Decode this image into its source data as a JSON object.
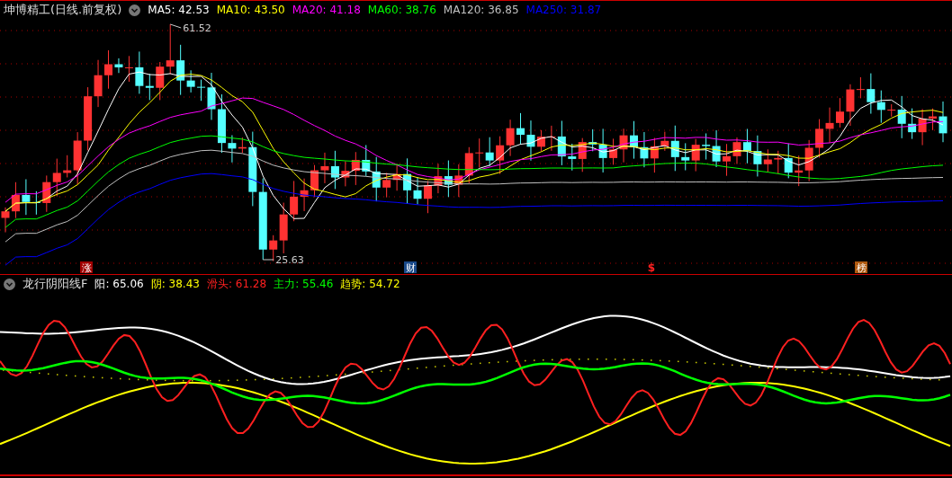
{
  "main_panel": {
    "title": "坤博精工(日线.前复权)",
    "legend": [
      {
        "label": "MA5: 42.53",
        "color": "#ffffff"
      },
      {
        "label": "MA10: 43.50",
        "color": "#ffff00"
      },
      {
        "label": "MA20: 41.18",
        "color": "#ff00ff"
      },
      {
        "label": "MA60: 38.76",
        "color": "#00ff00"
      },
      {
        "label": "MA120: 36.85",
        "color": "#c0c0c0"
      },
      {
        "label": "MA250: 31.87",
        "color": "#0000ff"
      }
    ],
    "high_label": "61.52",
    "low_label": "25.63",
    "markers": [
      {
        "label": "涨",
        "kind": "badge",
        "color": "#a00000"
      },
      {
        "label": "财",
        "kind": "badge",
        "color": "#1a4a8a"
      },
      {
        "label": "$",
        "kind": "text",
        "color": "#ff2020"
      },
      {
        "label": "榜",
        "kind": "badge",
        "color": "#b05a10"
      }
    ]
  },
  "indicator_panel": {
    "title": "龙行阴阳线F",
    "legend": [
      {
        "label": "阳: 65.06",
        "color": "#ffffff"
      },
      {
        "label": "阴: 38.43",
        "color": "#ffff00"
      },
      {
        "label": "滑头: 61.28",
        "color": "#ff2020"
      },
      {
        "label": "主力: 55.46",
        "color": "#00ff00"
      },
      {
        "label": "趋势: 54.72",
        "color": "#ffff00"
      }
    ]
  }
}
